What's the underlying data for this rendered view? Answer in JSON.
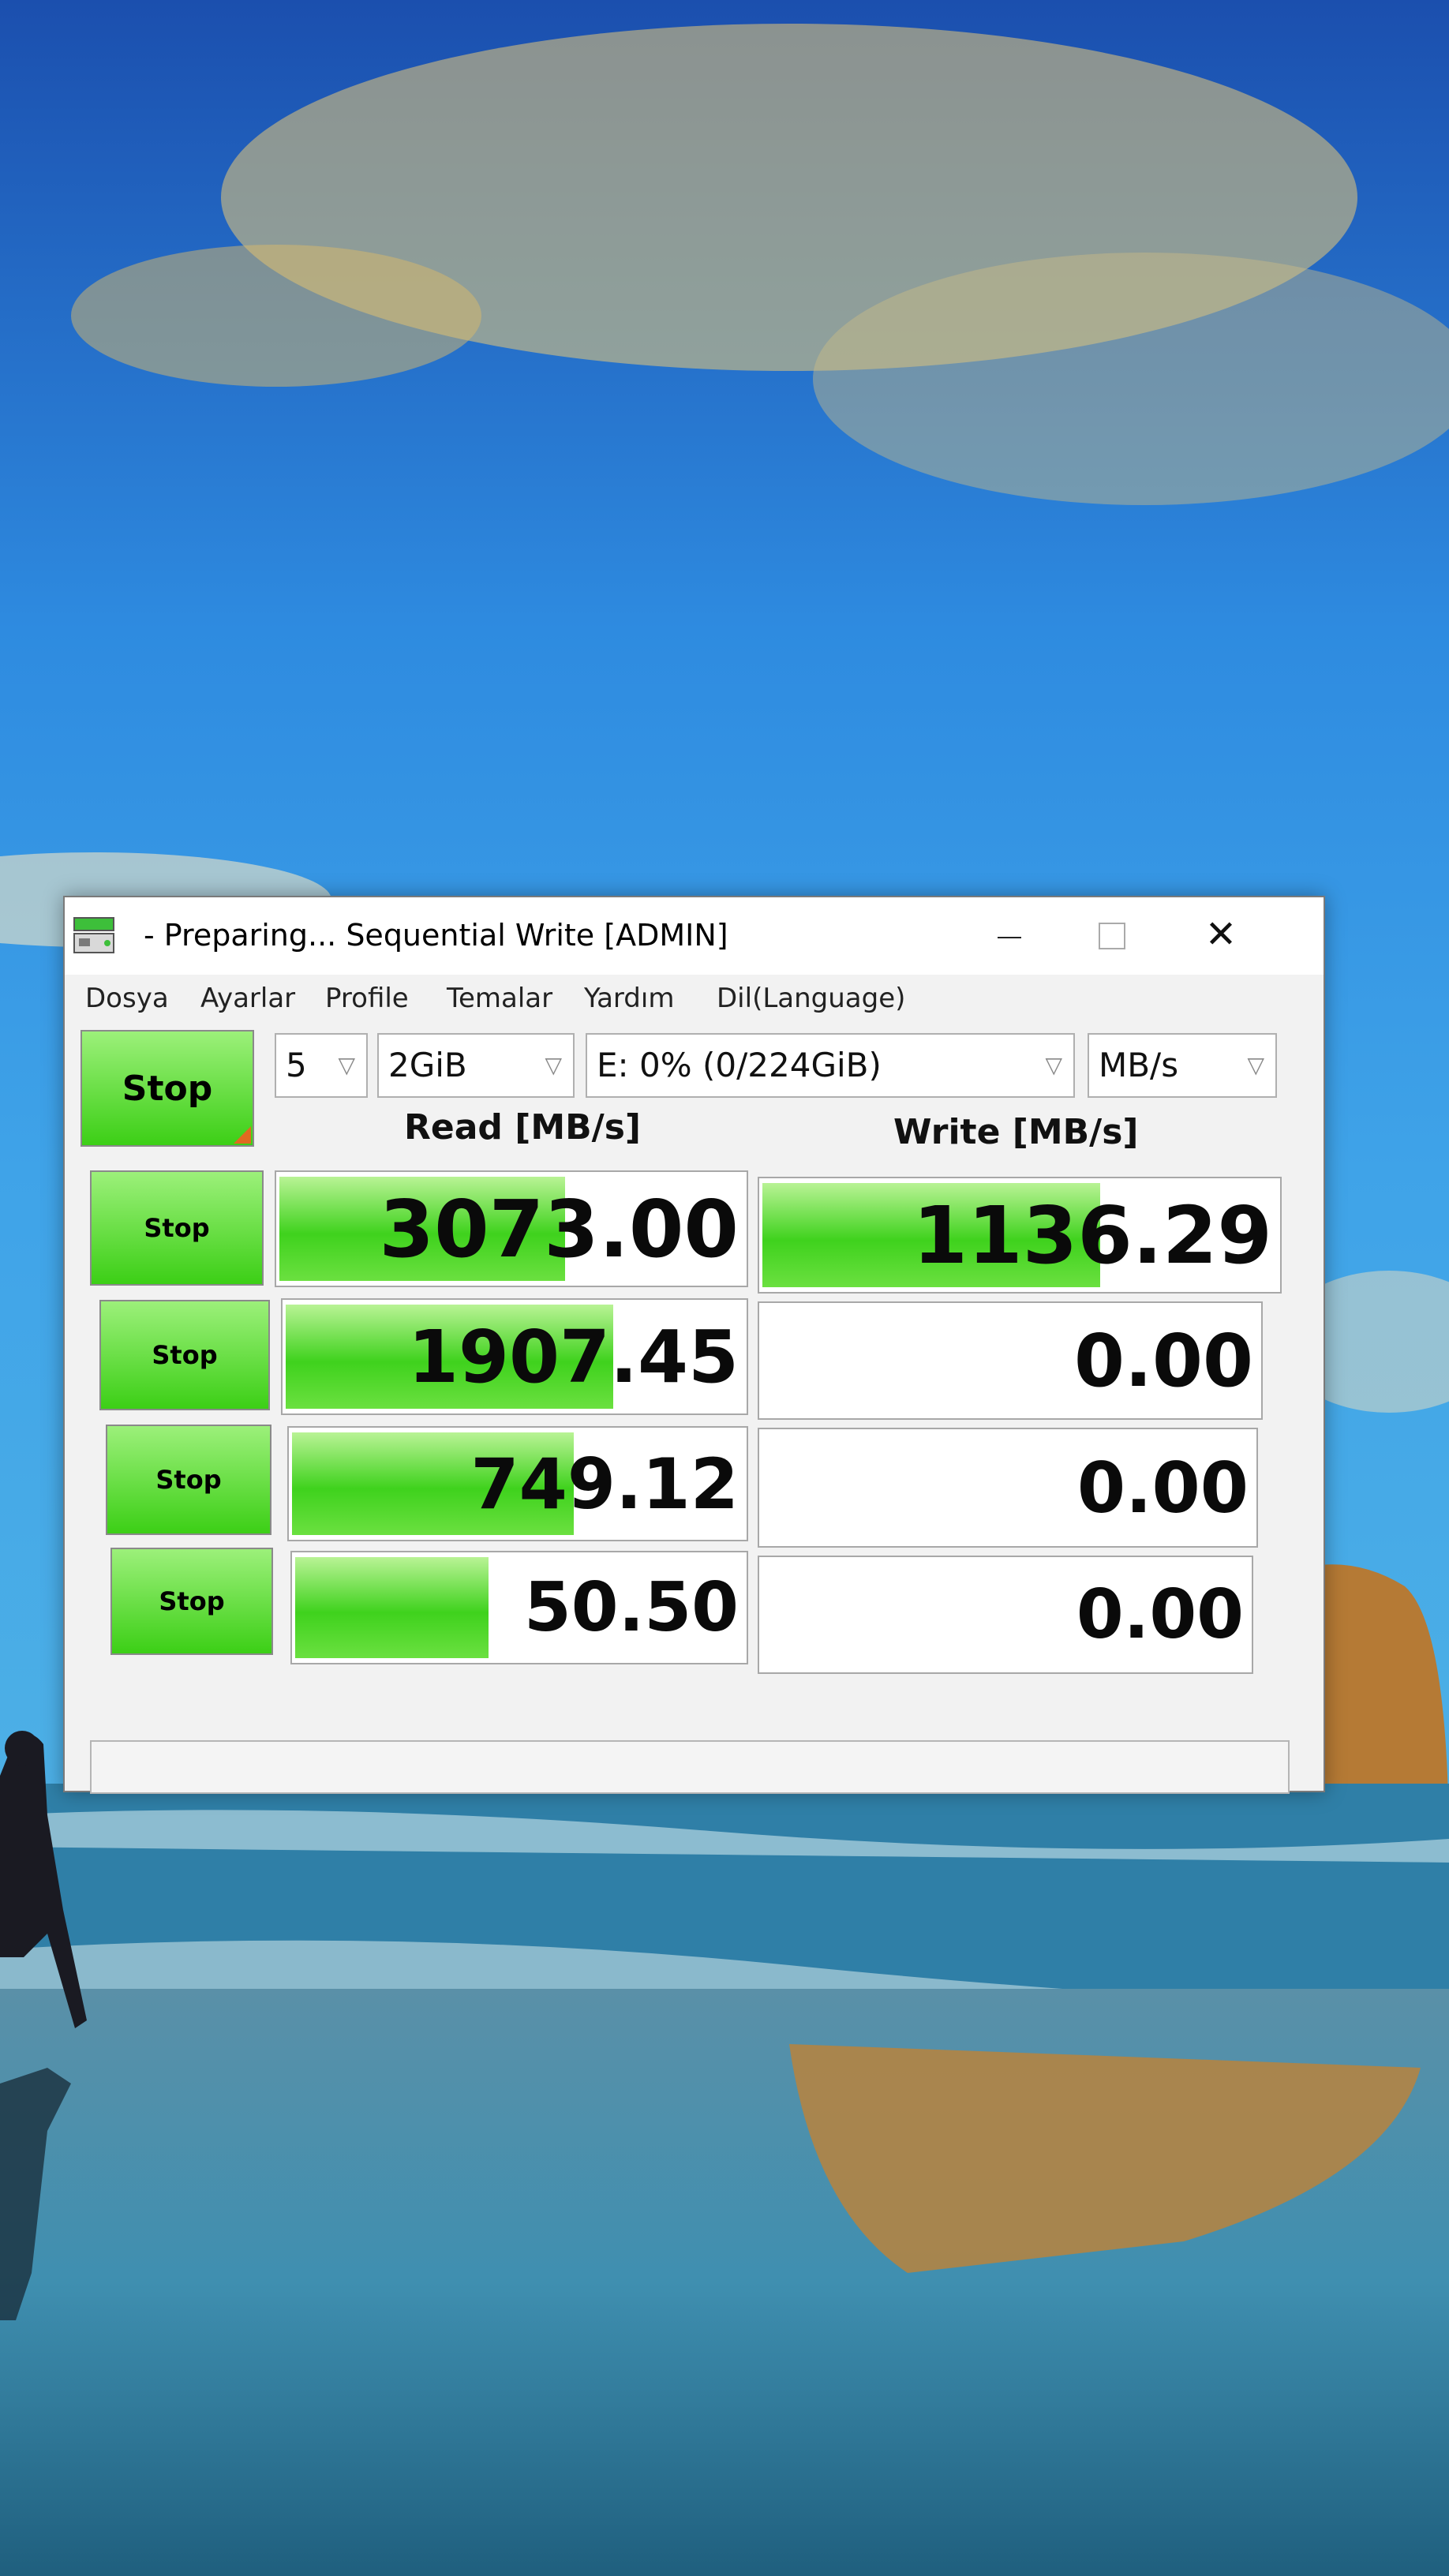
{
  "window": {
    "title": "- Preparing... Sequential Write [ADMIN]",
    "close_glyph": "✕",
    "icon": "disk-icon"
  },
  "menu": [
    "Dosya",
    "Ayarlar",
    "Profile",
    "Temalar",
    "Yardım",
    "Dil(Language)"
  ],
  "controls": {
    "main_button": "Stop",
    "count": "5",
    "size": "2GiB",
    "drive": "E: 0% (0/224GiB)",
    "unit": "MB/s"
  },
  "headers": {
    "read": "Read [MB/s]",
    "write": "Write [MB/s]"
  },
  "rows": [
    {
      "button": "Stop",
      "read": "3073.00",
      "write": "1136.29",
      "read_fill": 0.62,
      "write_fill": 0.66
    },
    {
      "button": "Stop",
      "read": "1907.45",
      "write": "0.00",
      "read_fill": 0.72,
      "write_fill": 0
    },
    {
      "button": "Stop",
      "read": "749.12",
      "write": "0.00",
      "read_fill": 0.63,
      "write_fill": 0
    },
    {
      "button": "Stop",
      "read": "50.50",
      "write": "0.00",
      "read_fill": 0.44,
      "write_fill": 0
    }
  ],
  "colors": {
    "accent_green": "#3ccf16",
    "progress_green": "#3fd21d",
    "corner_orange": "#e06a20"
  }
}
